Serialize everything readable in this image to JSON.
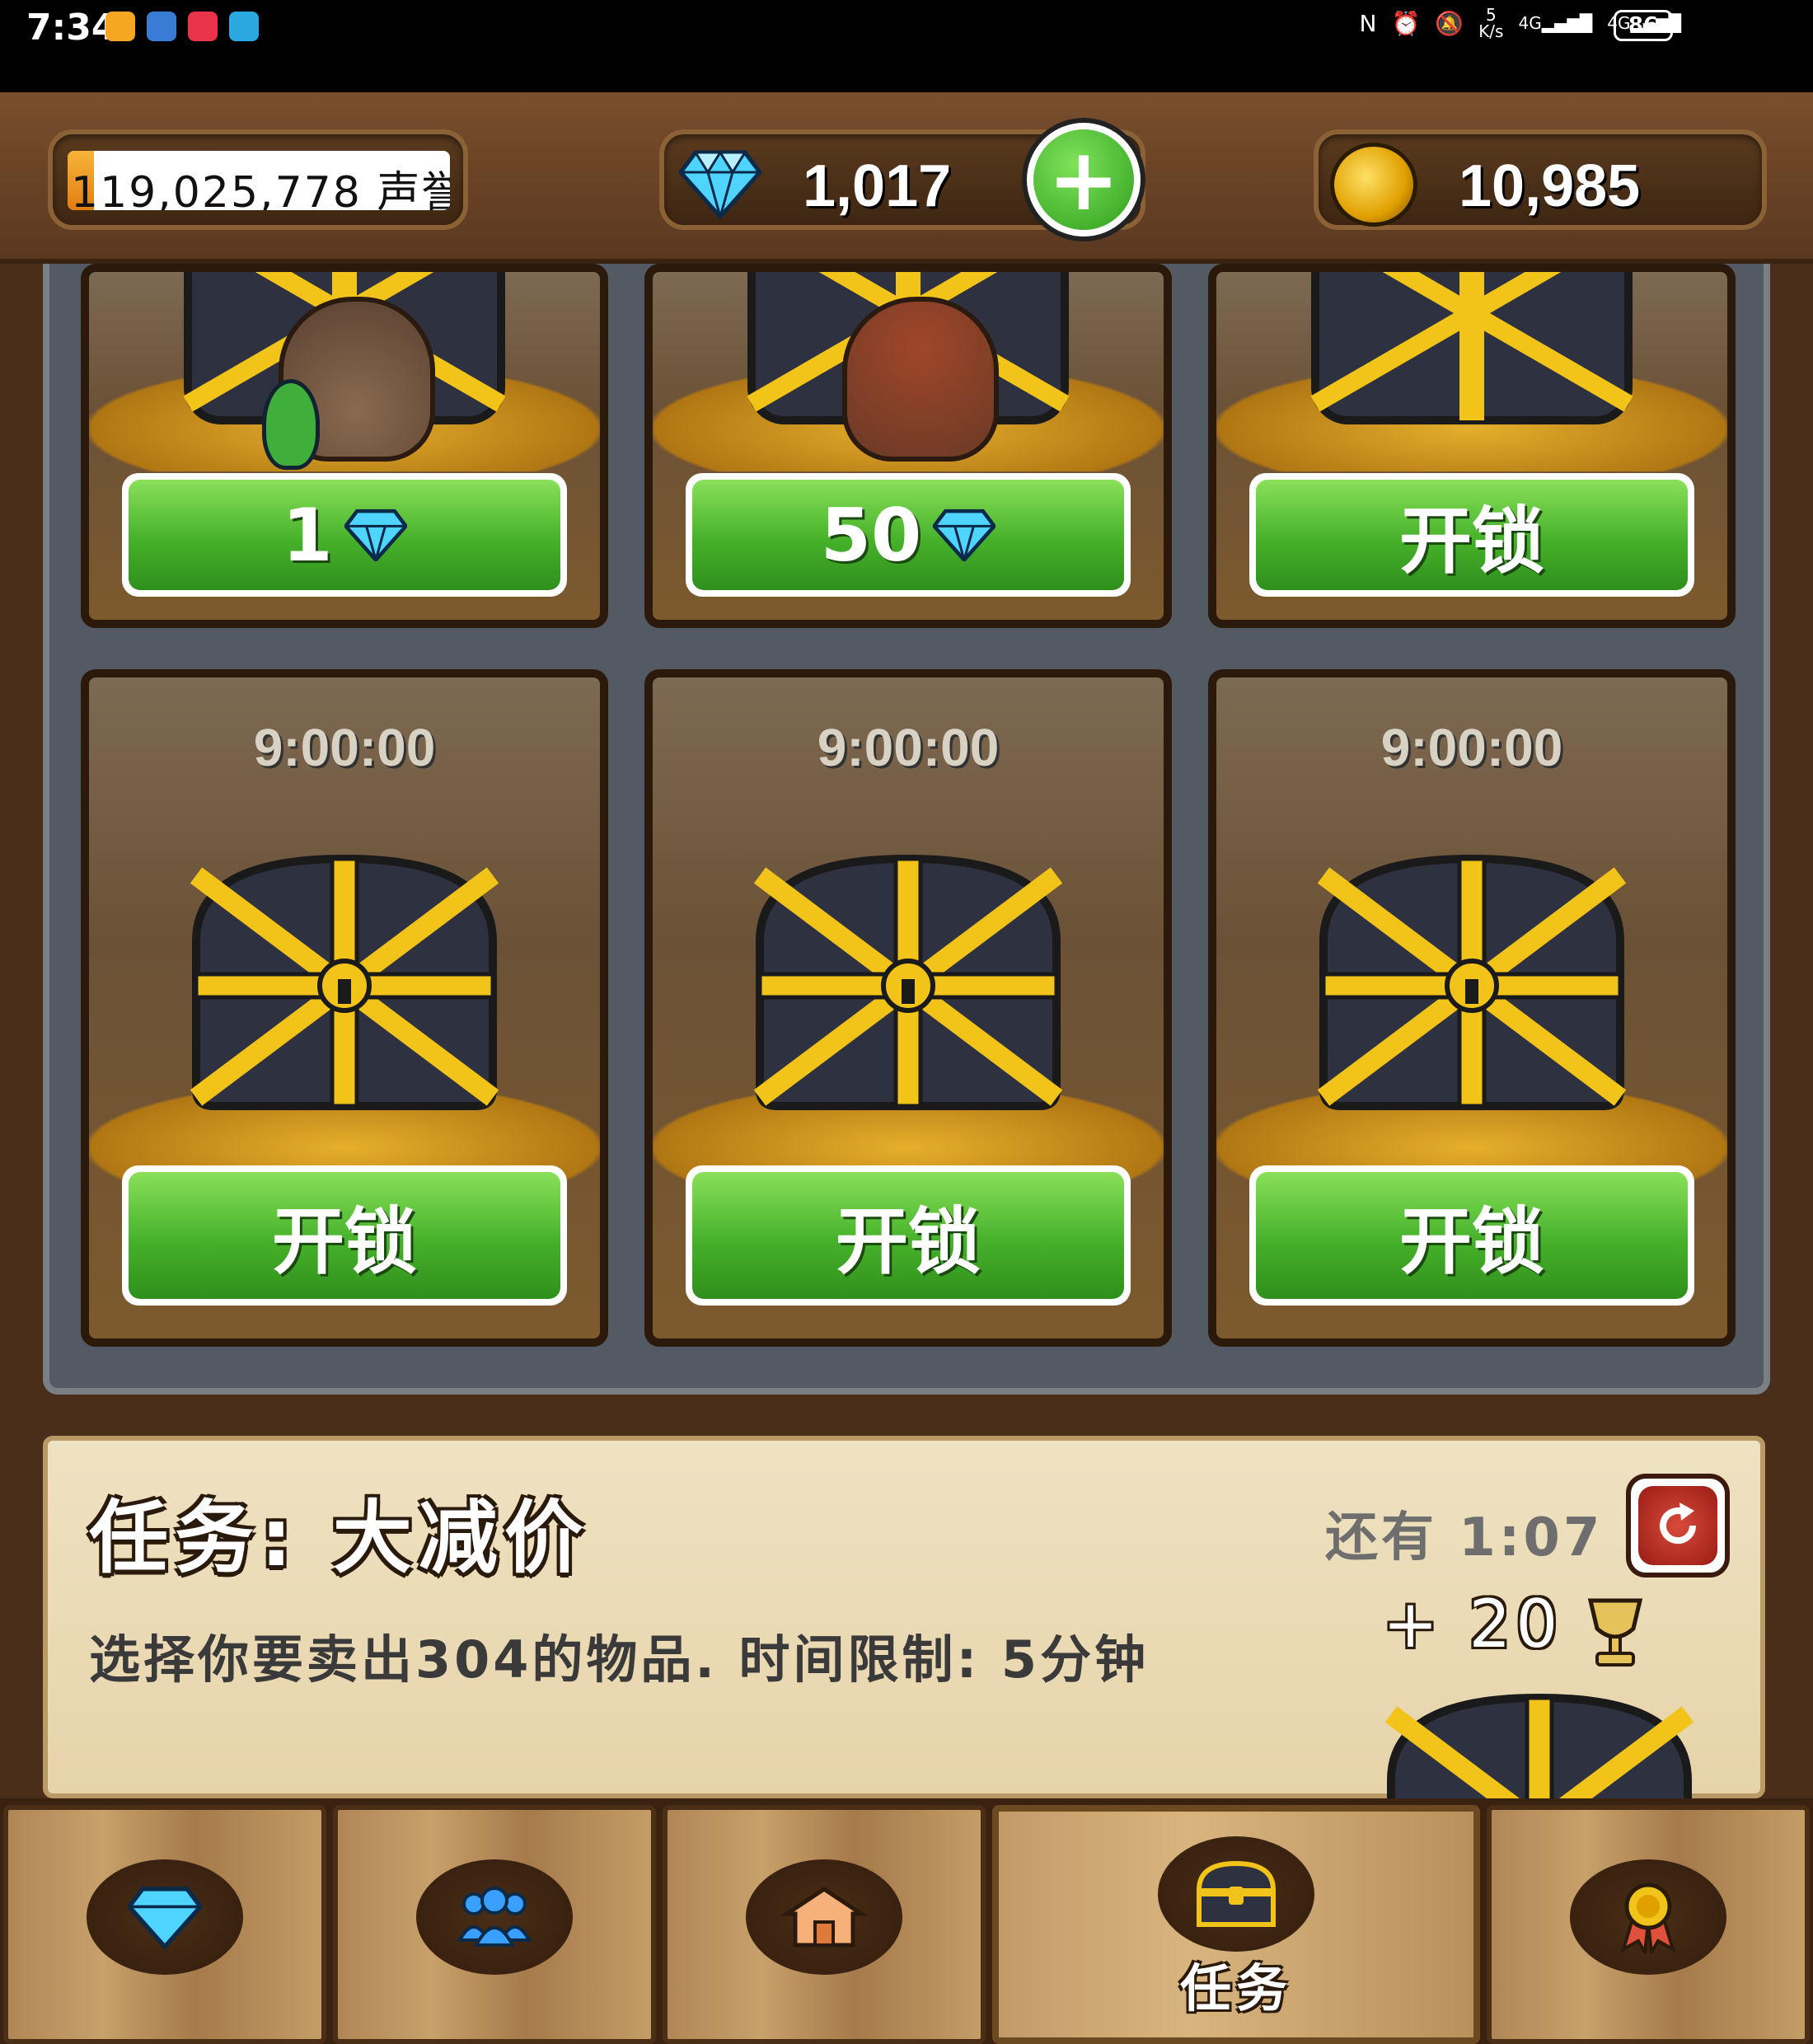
{
  "status_bar": {
    "time": "7:34",
    "net_speed_value": "5",
    "net_speed_unit": "K/s",
    "network_1": "4G",
    "network_2": "4G",
    "battery": "86"
  },
  "currency": {
    "fame_text": "119,025,778 声誉",
    "fame_progress": 0.07,
    "gems": "1,017",
    "gold": "10,985"
  },
  "chests_top": [
    {
      "button": "1",
      "button_icon": "diamond-icon"
    },
    {
      "button": "50",
      "button_icon": "diamond-icon"
    },
    {
      "button": "开锁"
    }
  ],
  "chests_bottom": [
    {
      "timer": "9:00:00",
      "button": "开锁"
    },
    {
      "timer": "9:00:00",
      "button": "开锁"
    },
    {
      "timer": "9:00:00",
      "button": "开锁"
    }
  ],
  "quest": {
    "title": "任务: 大减价",
    "remaining": "还有 1:07",
    "description": "选择你要卖出304的物品. 时间限制: 5分钟",
    "reward": "+ 20"
  },
  "nav": {
    "tabs": [
      {
        "icon": "diamond-icon",
        "label": ""
      },
      {
        "icon": "people-icon",
        "label": ""
      },
      {
        "icon": "house-icon",
        "label": ""
      },
      {
        "icon": "chest-icon",
        "label": "任务",
        "active": true
      },
      {
        "icon": "medal-icon",
        "label": ""
      }
    ]
  },
  "colors": {
    "button_green": "#46b12a",
    "wood_brown": "#7a4f2c",
    "gold": "#f3b82a"
  }
}
